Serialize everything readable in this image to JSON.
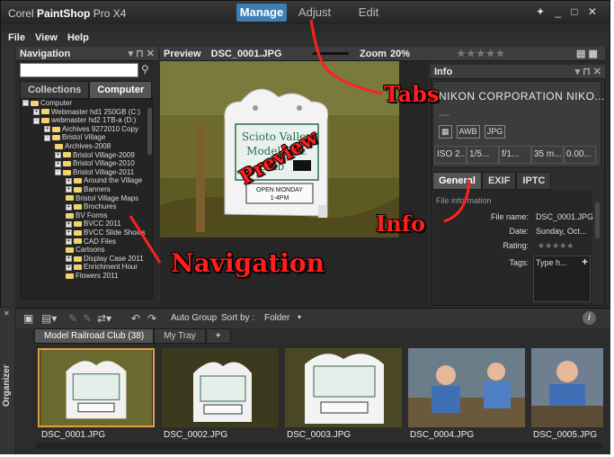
{
  "app": {
    "brand": "Corel",
    "product": "PaintShop",
    "version": "Pro X4"
  },
  "tabs": [
    "Manage",
    "Adjust",
    "Edit"
  ],
  "window_controls": "✦ _ □ ✕",
  "menu": [
    "File",
    "View",
    "Help"
  ],
  "navigation": {
    "title": "Navigation",
    "search_placeholder": "",
    "tabs": [
      "Collections",
      "Computer"
    ],
    "tree": [
      {
        "level": 0,
        "label": "Computer",
        "toggle": "-"
      },
      {
        "level": 1,
        "label": "Webmaster hd1 250GB (C:)",
        "toggle": "+"
      },
      {
        "level": 1,
        "label": "webmaster hd2 1TB-a (D:)",
        "toggle": "-"
      },
      {
        "level": 2,
        "label": "Archives 9272010 Copy",
        "toggle": "+"
      },
      {
        "level": 2,
        "label": "Bristol Village",
        "toggle": "-"
      },
      {
        "level": 3,
        "label": "Archives-2008",
        "toggle": ""
      },
      {
        "level": 3,
        "label": "Bristol Village-2009",
        "toggle": "+"
      },
      {
        "level": 3,
        "label": "Bristol Village-2010",
        "toggle": "+"
      },
      {
        "level": 3,
        "label": "Bristol Village-2011",
        "toggle": "-"
      },
      {
        "level": 4,
        "label": "Around the Village",
        "toggle": "+"
      },
      {
        "level": 4,
        "label": "Banners",
        "toggle": "+"
      },
      {
        "level": 4,
        "label": "Bristol Village Maps",
        "toggle": ""
      },
      {
        "level": 4,
        "label": "Brochures",
        "toggle": "+"
      },
      {
        "level": 4,
        "label": "BV Forms",
        "toggle": ""
      },
      {
        "level": 4,
        "label": "BVCC 2011",
        "toggle": "+"
      },
      {
        "level": 4,
        "label": "BVCC Slide Shows",
        "toggle": "+"
      },
      {
        "level": 4,
        "label": "CAD Files",
        "toggle": "+"
      },
      {
        "level": 4,
        "label": "Cartoons",
        "toggle": ""
      },
      {
        "level": 4,
        "label": "Display Case 2011",
        "toggle": "+"
      },
      {
        "level": 4,
        "label": "Enrichment Hour",
        "toggle": "+"
      },
      {
        "level": 4,
        "label": "Flowers 2011",
        "toggle": ""
      }
    ]
  },
  "preview": {
    "label": "Preview",
    "filename": "DSC_0001.JPG",
    "zoom_label": "Zoom",
    "zoom_value": "20%",
    "rating": "★★★★★"
  },
  "sign": {
    "line1": "Scioto Valley",
    "line2": "Model R.R.",
    "line3": "Club",
    "plate1": "OPEN MONDAY",
    "plate2": "1-4PM"
  },
  "info": {
    "title": "Info",
    "camera": "NIKON CORPORATION NIKO...",
    "dash": "---",
    "badges": [
      "AWB",
      "JPG"
    ],
    "exif": [
      "ISO 2...",
      "1/5...",
      "f/1...",
      "35 m...",
      "0.00..."
    ],
    "tabs": [
      "General",
      "EXIF",
      "IPTC"
    ],
    "section": "File information",
    "fields": [
      {
        "label": "File name:",
        "value": "DSC_0001.JPG"
      },
      {
        "label": "Date:",
        "value": "Sunday, Oct..."
      },
      {
        "label": "Rating:",
        "value": "★★★★★"
      },
      {
        "label": "Tags:",
        "value": "Type h..."
      }
    ]
  },
  "organizer": {
    "side_label": "Organizer",
    "toolbar": {
      "auto_group": "Auto Group",
      "sort_by": "Sort by :",
      "sort_value": "Folder"
    },
    "tabs": [
      "Model Railroad Club (38)",
      "My Tray",
      "+"
    ],
    "thumbnails": [
      "DSC_0001.JPG",
      "DSC_0002.JPG",
      "DSC_0003.JPG",
      "DSC_0004.JPG",
      "DSC_0005.JPG"
    ]
  },
  "annotations": [
    "Tabs",
    "Preview",
    "Info",
    "Navigation"
  ],
  "colors": {
    "accent": "#3c7fb4",
    "annotation": "#ff1f1f",
    "folder": "#f2d36d"
  }
}
